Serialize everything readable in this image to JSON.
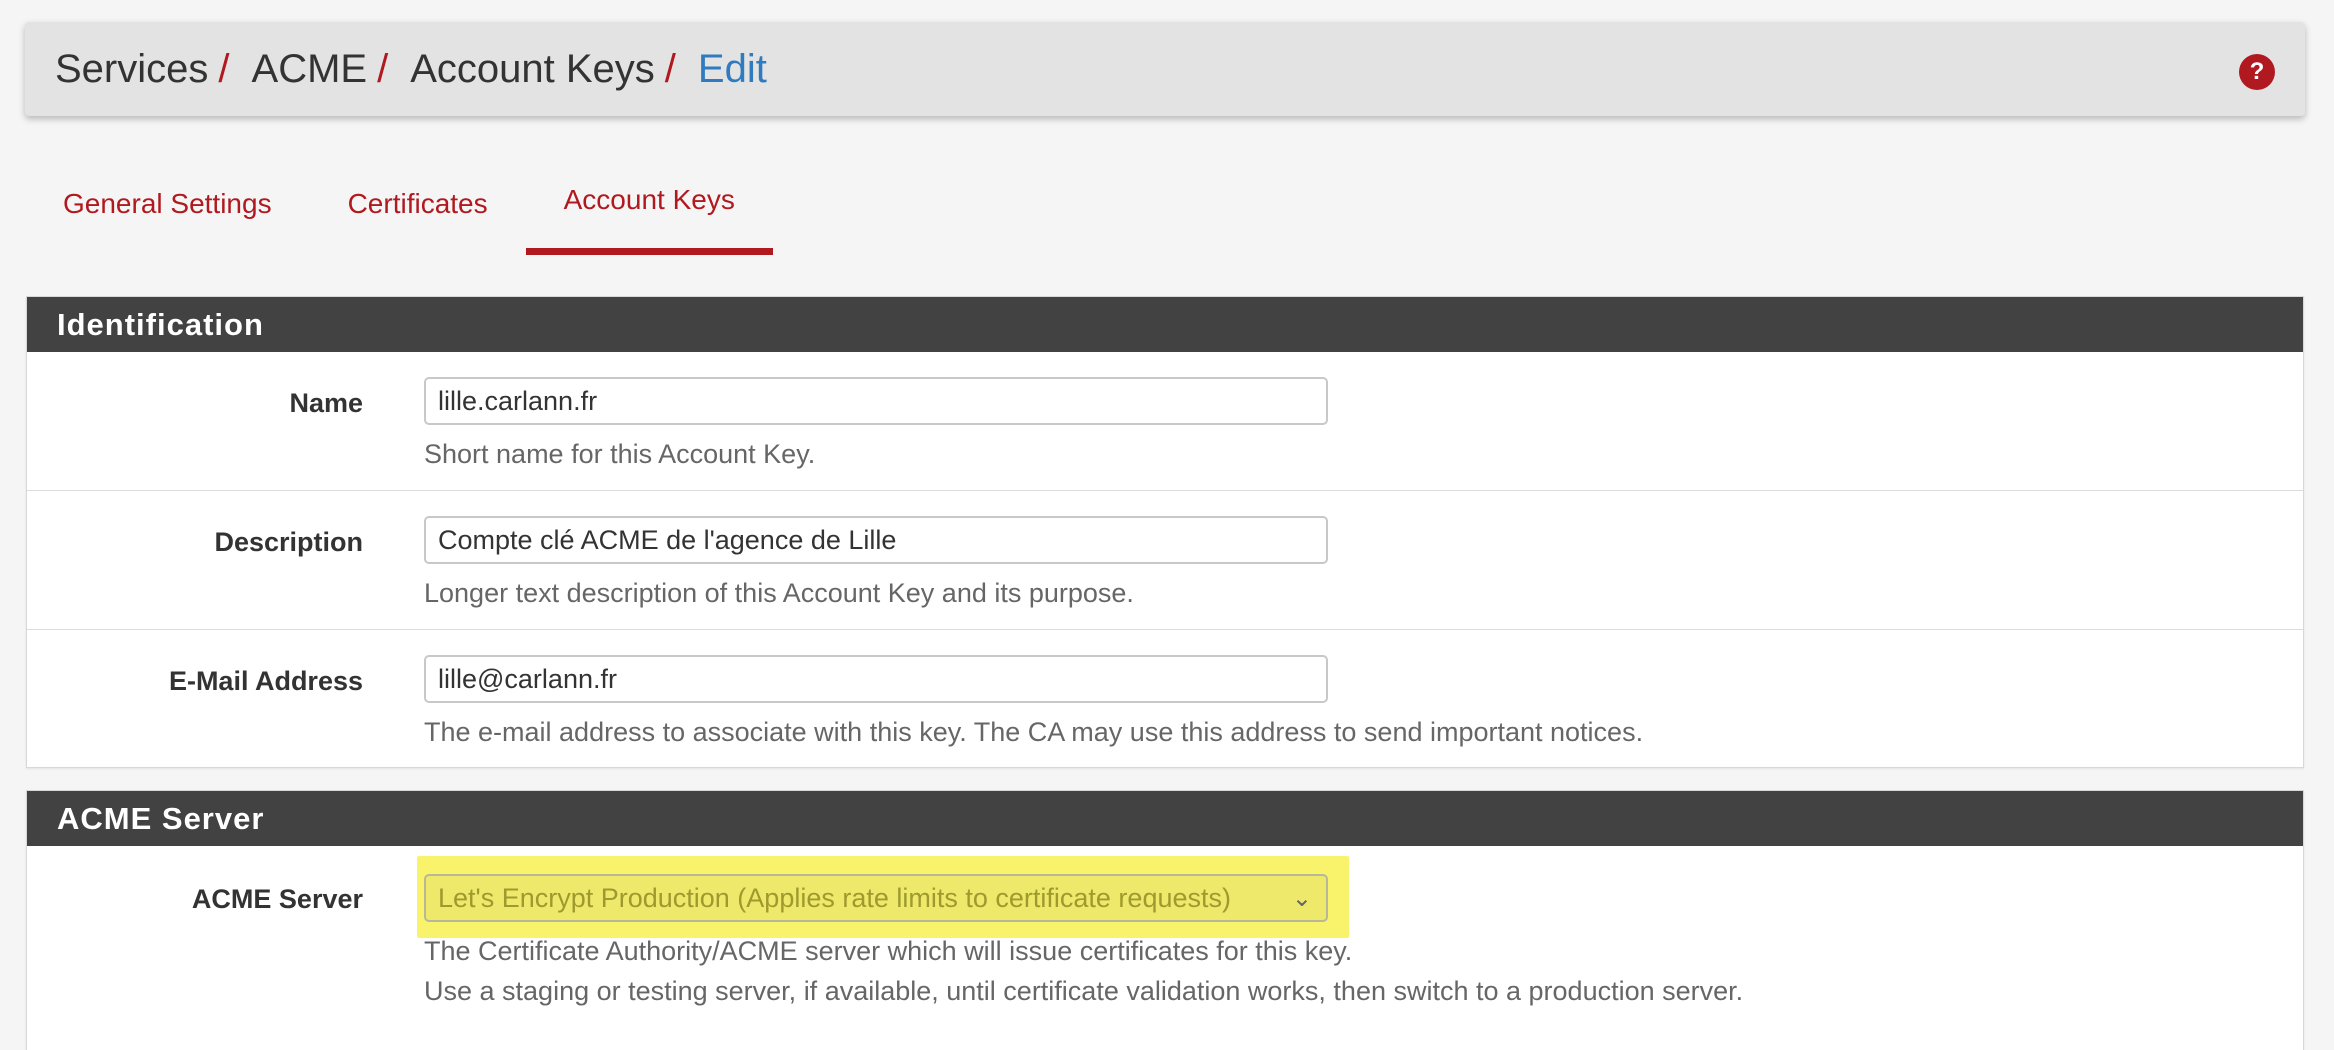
{
  "breadcrumb": {
    "items": [
      "Services",
      "ACME",
      "Account Keys"
    ],
    "separator": "/",
    "current": "Edit"
  },
  "help_icon": "question-circle-icon",
  "tabs": [
    {
      "label": "General Settings",
      "active": false
    },
    {
      "label": "Certificates",
      "active": false
    },
    {
      "label": "Account Keys",
      "active": true
    }
  ],
  "identification": {
    "heading": "Identification",
    "name": {
      "label": "Name",
      "value": "lille.carlann.fr",
      "help": "Short name for this Account Key."
    },
    "description": {
      "label": "Description",
      "value": "Compte clé ACME de l'agence de Lille",
      "help": "Longer text description of this Account Key and its purpose."
    },
    "email": {
      "label": "E-Mail Address",
      "value": "lille@carlann.fr",
      "help": "The e-mail address to associate with this key. The CA may use this address to send important notices."
    }
  },
  "acme_server": {
    "heading": "ACME Server",
    "label": "ACME Server",
    "selected": "Let's Encrypt Production (Applies rate limits to certificate requests)",
    "help_line1": "The Certificate Authority/ACME server which will issue certificates for this key.",
    "help_line2": "Use a staging or testing server, if available, until certificate validation works, then switch to a production server."
  },
  "colors": {
    "accent": "#b0191f",
    "link_active": "#2f7bbf",
    "panel_heading": "#424242",
    "highlight": "#f8f36a"
  }
}
